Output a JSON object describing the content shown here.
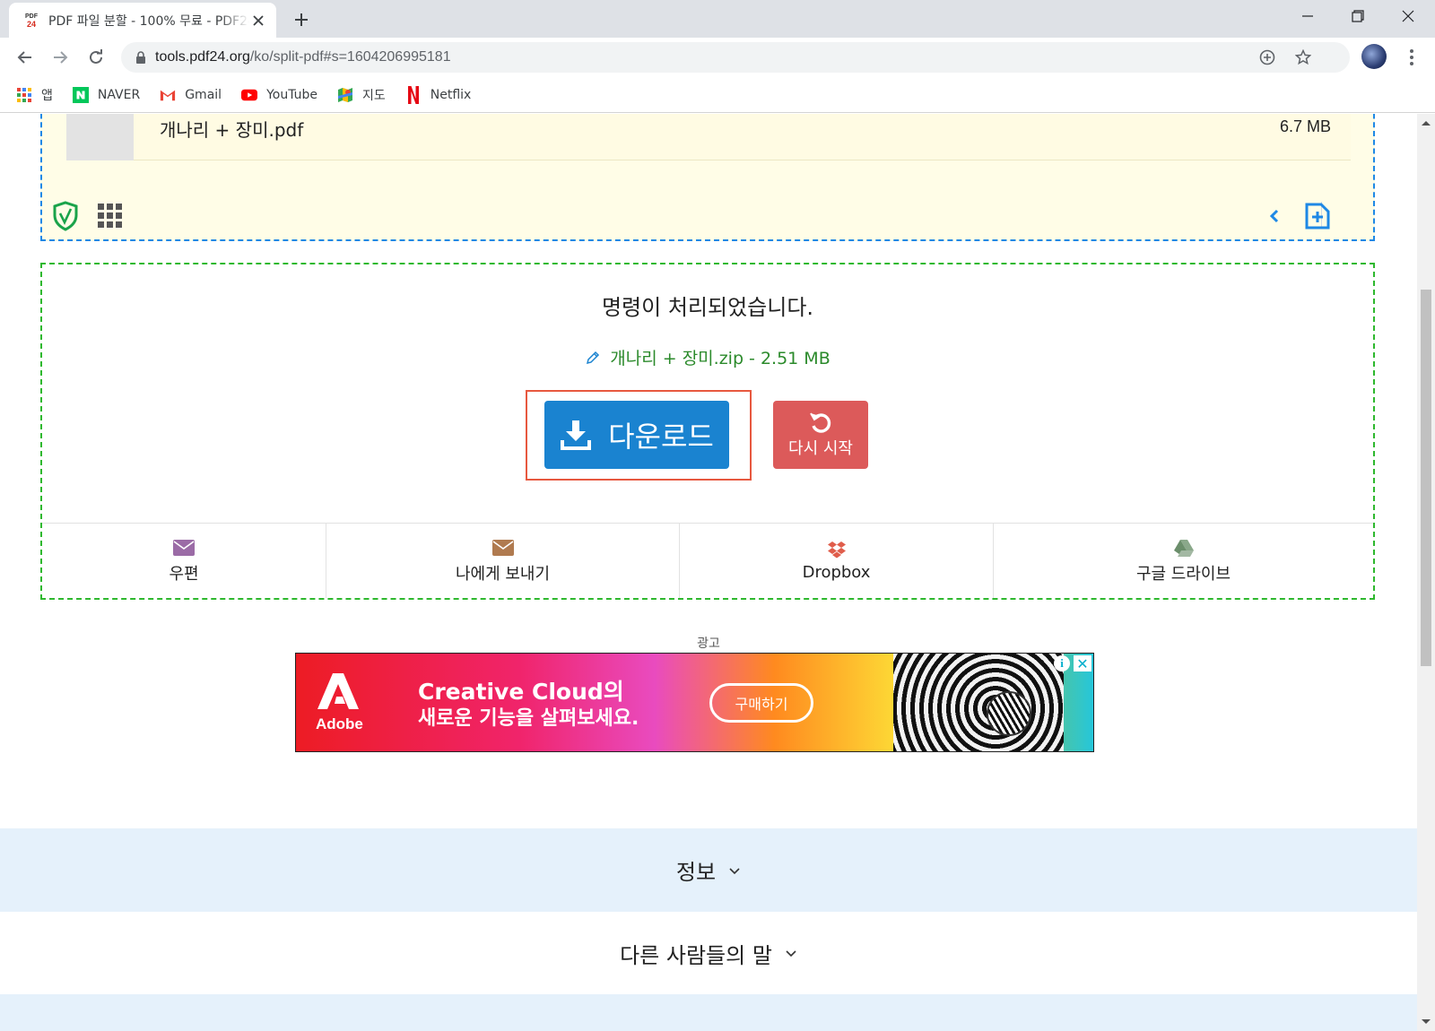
{
  "browser": {
    "tab": {
      "title": "PDF 파일 분할 - 100% 무료 - PDF24",
      "favicon_top": "PDF",
      "favicon_bottom": "24"
    },
    "url_host": "tools.pdf24.org",
    "url_path": "/ko/split-pdf#s=1604206995181",
    "bookmarks": [
      {
        "label": "앱",
        "icon": "apps-grid-icon"
      },
      {
        "label": "NAVER",
        "icon": "naver-icon"
      },
      {
        "label": "Gmail",
        "icon": "gmail-icon"
      },
      {
        "label": "YouTube",
        "icon": "youtube-icon"
      },
      {
        "label": "지도",
        "icon": "maps-icon"
      },
      {
        "label": "Netflix",
        "icon": "netflix-icon"
      }
    ]
  },
  "upload": {
    "file_name": "개나리 + 장미.pdf",
    "file_size": "6.7 MB"
  },
  "result": {
    "title": "명령이 처리되었습니다.",
    "output_file": "개나리 + 장미.zip - 2.51 MB",
    "download_label": "다운로드",
    "restart_label": "다시 시작",
    "share": [
      {
        "label": "우편",
        "icon": "envelope-icon",
        "color": "#9b6ba6"
      },
      {
        "label": "나에게 보내기",
        "icon": "envelope-icon",
        "color": "#b07a4f"
      },
      {
        "label": "Dropbox",
        "icon": "dropbox-icon",
        "color": "#e05d4b"
      },
      {
        "label": "구글 드라이브",
        "icon": "google-drive-icon",
        "color": "#6b8e6b"
      }
    ]
  },
  "ad": {
    "label": "광고",
    "brand": "Adobe",
    "line1": "Creative Cloud의",
    "line2": "새로운 기능을 살펴보세요.",
    "cta": "구매하기"
  },
  "sections": {
    "info": "정보",
    "reviews": "다른 사람들의 말"
  },
  "colors": {
    "download": "#1a83d0",
    "restart": "#dc5a5a",
    "highlight": "#e7583f",
    "success_text": "#2b8a2b",
    "info_bg": "#e5f1fb"
  }
}
